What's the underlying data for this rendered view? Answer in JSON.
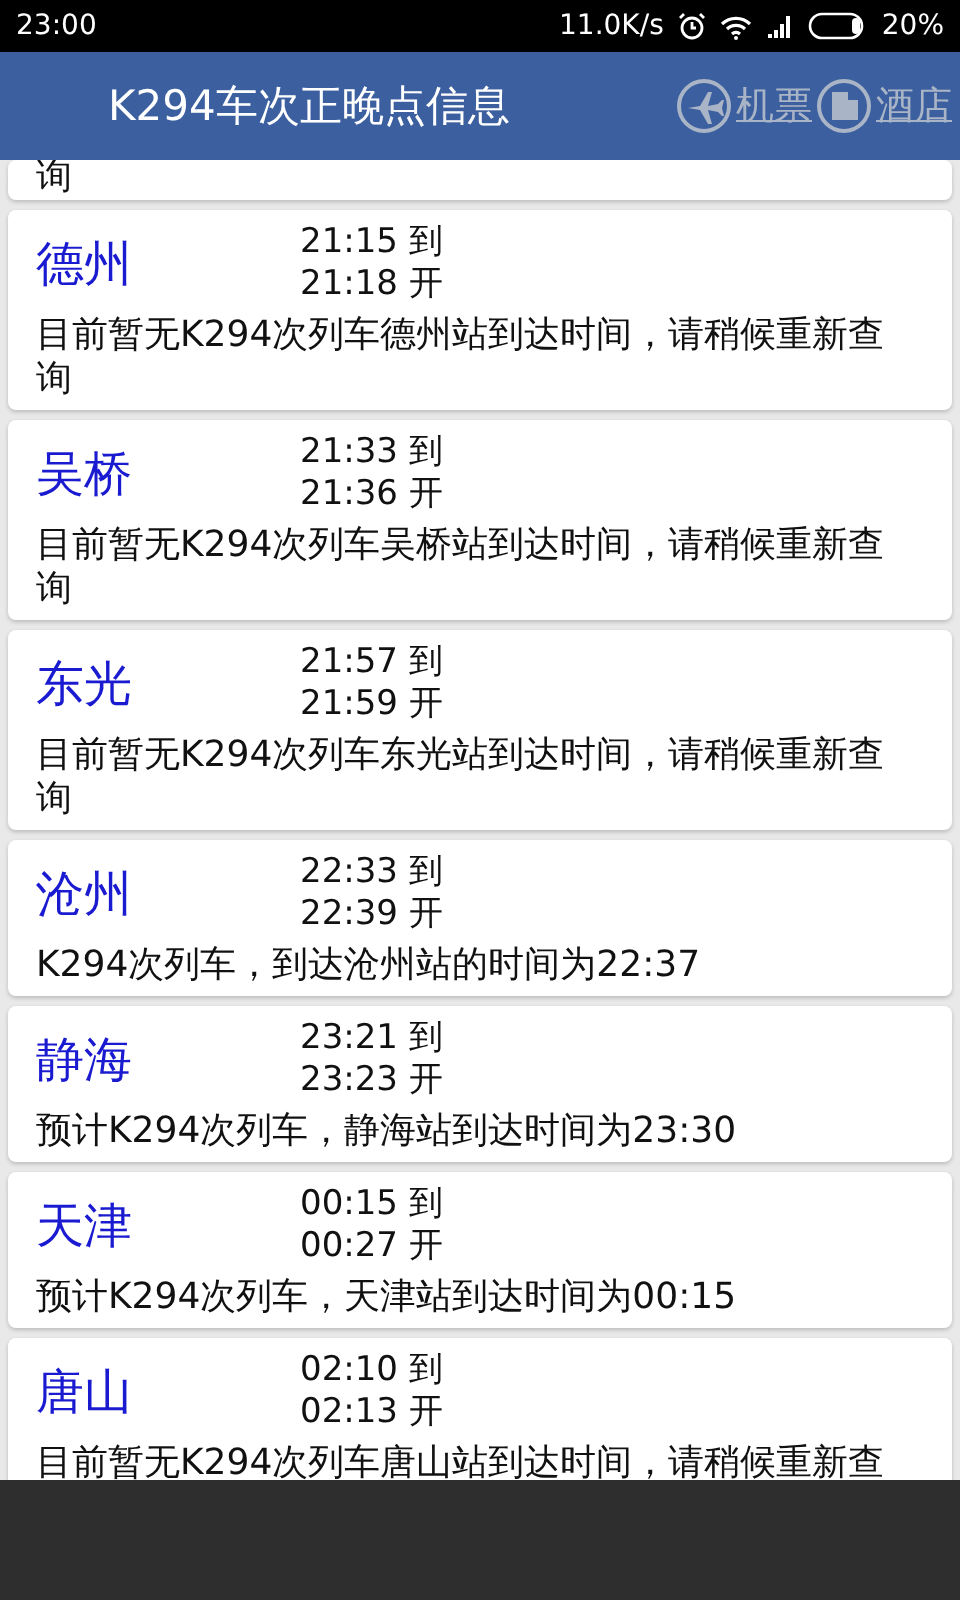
{
  "status_bar": {
    "time": "23:00",
    "speed": "11.0K/s",
    "battery": "20%"
  },
  "header": {
    "title": "K294车次正晚点信息",
    "links": [
      {
        "label": "机票",
        "kind": "plane"
      },
      {
        "label": "酒店",
        "kind": "hotel"
      }
    ]
  },
  "stops": [
    {
      "kind": "partial",
      "note": "询"
    },
    {
      "kind": "full",
      "station": "德州",
      "arrive": "21:15 到",
      "depart": "21:18 开",
      "note": "目前暂无K294次列车德州站到达时间，请稍候重新查询"
    },
    {
      "kind": "full",
      "station": "吴桥",
      "arrive": "21:33 到",
      "depart": "21:36 开",
      "note": "目前暂无K294次列车吴桥站到达时间，请稍候重新查询"
    },
    {
      "kind": "full",
      "station": "东光",
      "arrive": "21:57 到",
      "depart": "21:59 开",
      "note": "目前暂无K294次列车东光站到达时间，请稍候重新查询"
    },
    {
      "kind": "full",
      "station": "沧州",
      "arrive": "22:33 到",
      "depart": "22:39 开",
      "note": "K294次列车，到达沧州站的时间为22:37"
    },
    {
      "kind": "full",
      "station": "静海",
      "arrive": "23:21 到",
      "depart": "23:23 开",
      "note": "预计K294次列车，静海站到达时间为23:30"
    },
    {
      "kind": "full",
      "station": "天津",
      "arrive": "00:15 到",
      "depart": "00:27 开",
      "note": "预计K294次列车，天津站到达时间为00:15"
    },
    {
      "kind": "full",
      "station": "唐山",
      "arrive": "02:10 到",
      "depart": "02:13 开",
      "note": "目前暂无K294次列车唐山站到达时间，请稍候重新查"
    }
  ]
}
